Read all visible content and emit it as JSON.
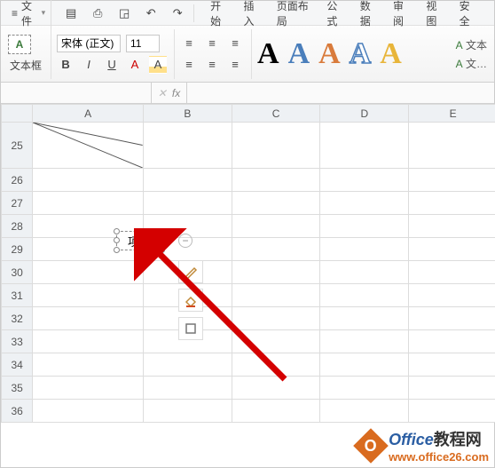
{
  "menubar": {
    "file_label": "文件",
    "tabs": [
      "开始",
      "插入",
      "页面布局",
      "公式",
      "数据",
      "审阅",
      "视图",
      "安全"
    ]
  },
  "ribbon": {
    "textbox_label": "文本框",
    "font_name": "宋体 (正文)",
    "font_size": "11",
    "bold": "B",
    "italic": "I",
    "underline": "U",
    "right_label1": "文本",
    "right_label2": "文…"
  },
  "wordart_glyph": "A",
  "formula_bar": {
    "name_box": "",
    "fx": "fx"
  },
  "columns": [
    "A",
    "B",
    "C",
    "D",
    "E"
  ],
  "rows": [
    "25",
    "26",
    "27",
    "28",
    "29",
    "30",
    "31",
    "32",
    "33",
    "34",
    "35",
    "36"
  ],
  "text_object": {
    "text": "项目"
  },
  "delete_symbol": "−",
  "watermark": {
    "brand_en": "Office",
    "brand_cn": "教程网",
    "url": "www.office26.com",
    "logo_letter": "O"
  }
}
